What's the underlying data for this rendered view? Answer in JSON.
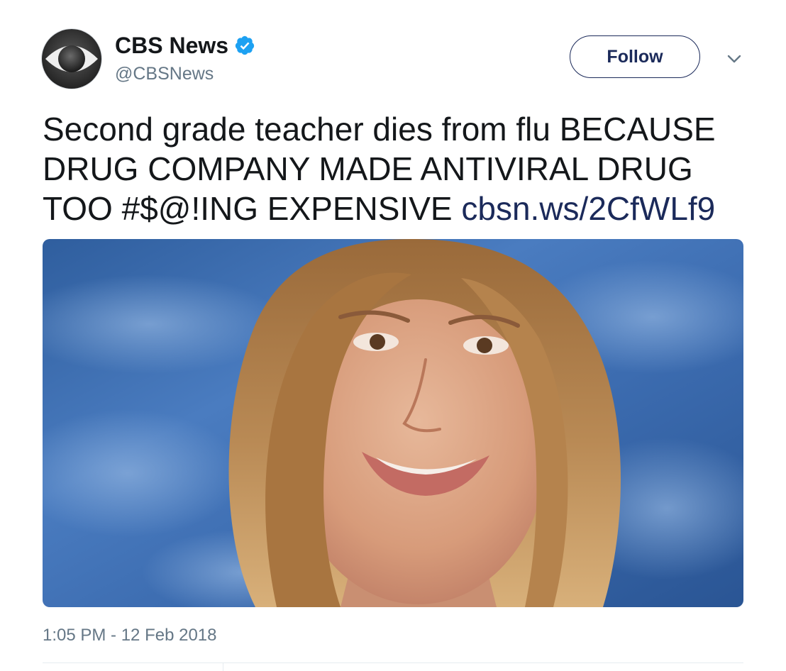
{
  "author": {
    "display_name": "CBS News",
    "handle": "@CBSNews",
    "verified": true,
    "avatar_icon": "cbs-eye-logo-icon"
  },
  "header": {
    "follow_label": "Follow",
    "menu_icon": "chevron-down-icon"
  },
  "tweet": {
    "text": "Second grade teacher dies from flu BECAUSE DRUG COMPANY MADE ANTIVIRAL DRUG TOO #$@!ING EXPENSIVE",
    "link_text": "cbsn.ws/2CfWLf9",
    "media_icon": "portrait-photo-icon",
    "timestamp": "1:05 PM - 12 Feb 2018"
  },
  "colors": {
    "link": "#1b2a5a",
    "text": "#14171a",
    "secondary": "#657786",
    "verified": "#1da1f2",
    "photo_background": "#3f6fb0"
  }
}
